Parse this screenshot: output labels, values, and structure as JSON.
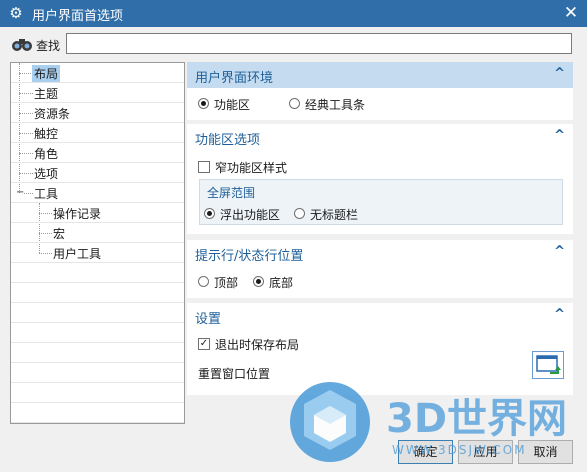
{
  "window": {
    "title": "用户界面首选项",
    "close_glyph": "✕",
    "gear_glyph": "⚙"
  },
  "search": {
    "label": "查找",
    "value": ""
  },
  "tree": {
    "items": [
      {
        "label": "布局",
        "selected": true
      },
      {
        "label": "主题"
      },
      {
        "label": "资源条"
      },
      {
        "label": "触控"
      },
      {
        "label": "角色"
      },
      {
        "label": "选项"
      },
      {
        "label": "工具",
        "expanded": true
      },
      {
        "label": "操作记录"
      },
      {
        "label": "宏"
      },
      {
        "label": "用户工具"
      }
    ],
    "collapse_glyph": "−"
  },
  "sections": {
    "ui_env": {
      "title": "用户界面环境",
      "options": [
        "功能区",
        "经典工具条"
      ],
      "selected": 0
    },
    "ribbon": {
      "title": "功能区选项",
      "narrow_label": "窄功能区样式",
      "narrow_checked": false,
      "fullscreen": {
        "title": "全屏范围",
        "options": [
          "浮出功能区",
          "无标题栏"
        ],
        "selected": 0
      }
    },
    "cue": {
      "title": "提示行/状态行位置",
      "options": [
        "顶部",
        "底部"
      ],
      "selected": 1
    },
    "settings": {
      "title": "设置",
      "save_label": "退出时保存布局",
      "save_checked": true,
      "reset_label": "重置窗口位置"
    }
  },
  "chevron_glyph": "^",
  "check_glyph": "✓",
  "buttons": {
    "ok": "确定",
    "apply": "应用",
    "cancel": "取消"
  },
  "watermark": {
    "brand": "3D世界网",
    "url": "WWW.3DSJW.COM"
  },
  "colors": {
    "titlebar": "#2f6ea8",
    "accent": "#1f5f99",
    "section_active": "#c5dcf0",
    "selection": "#a9cff0"
  }
}
